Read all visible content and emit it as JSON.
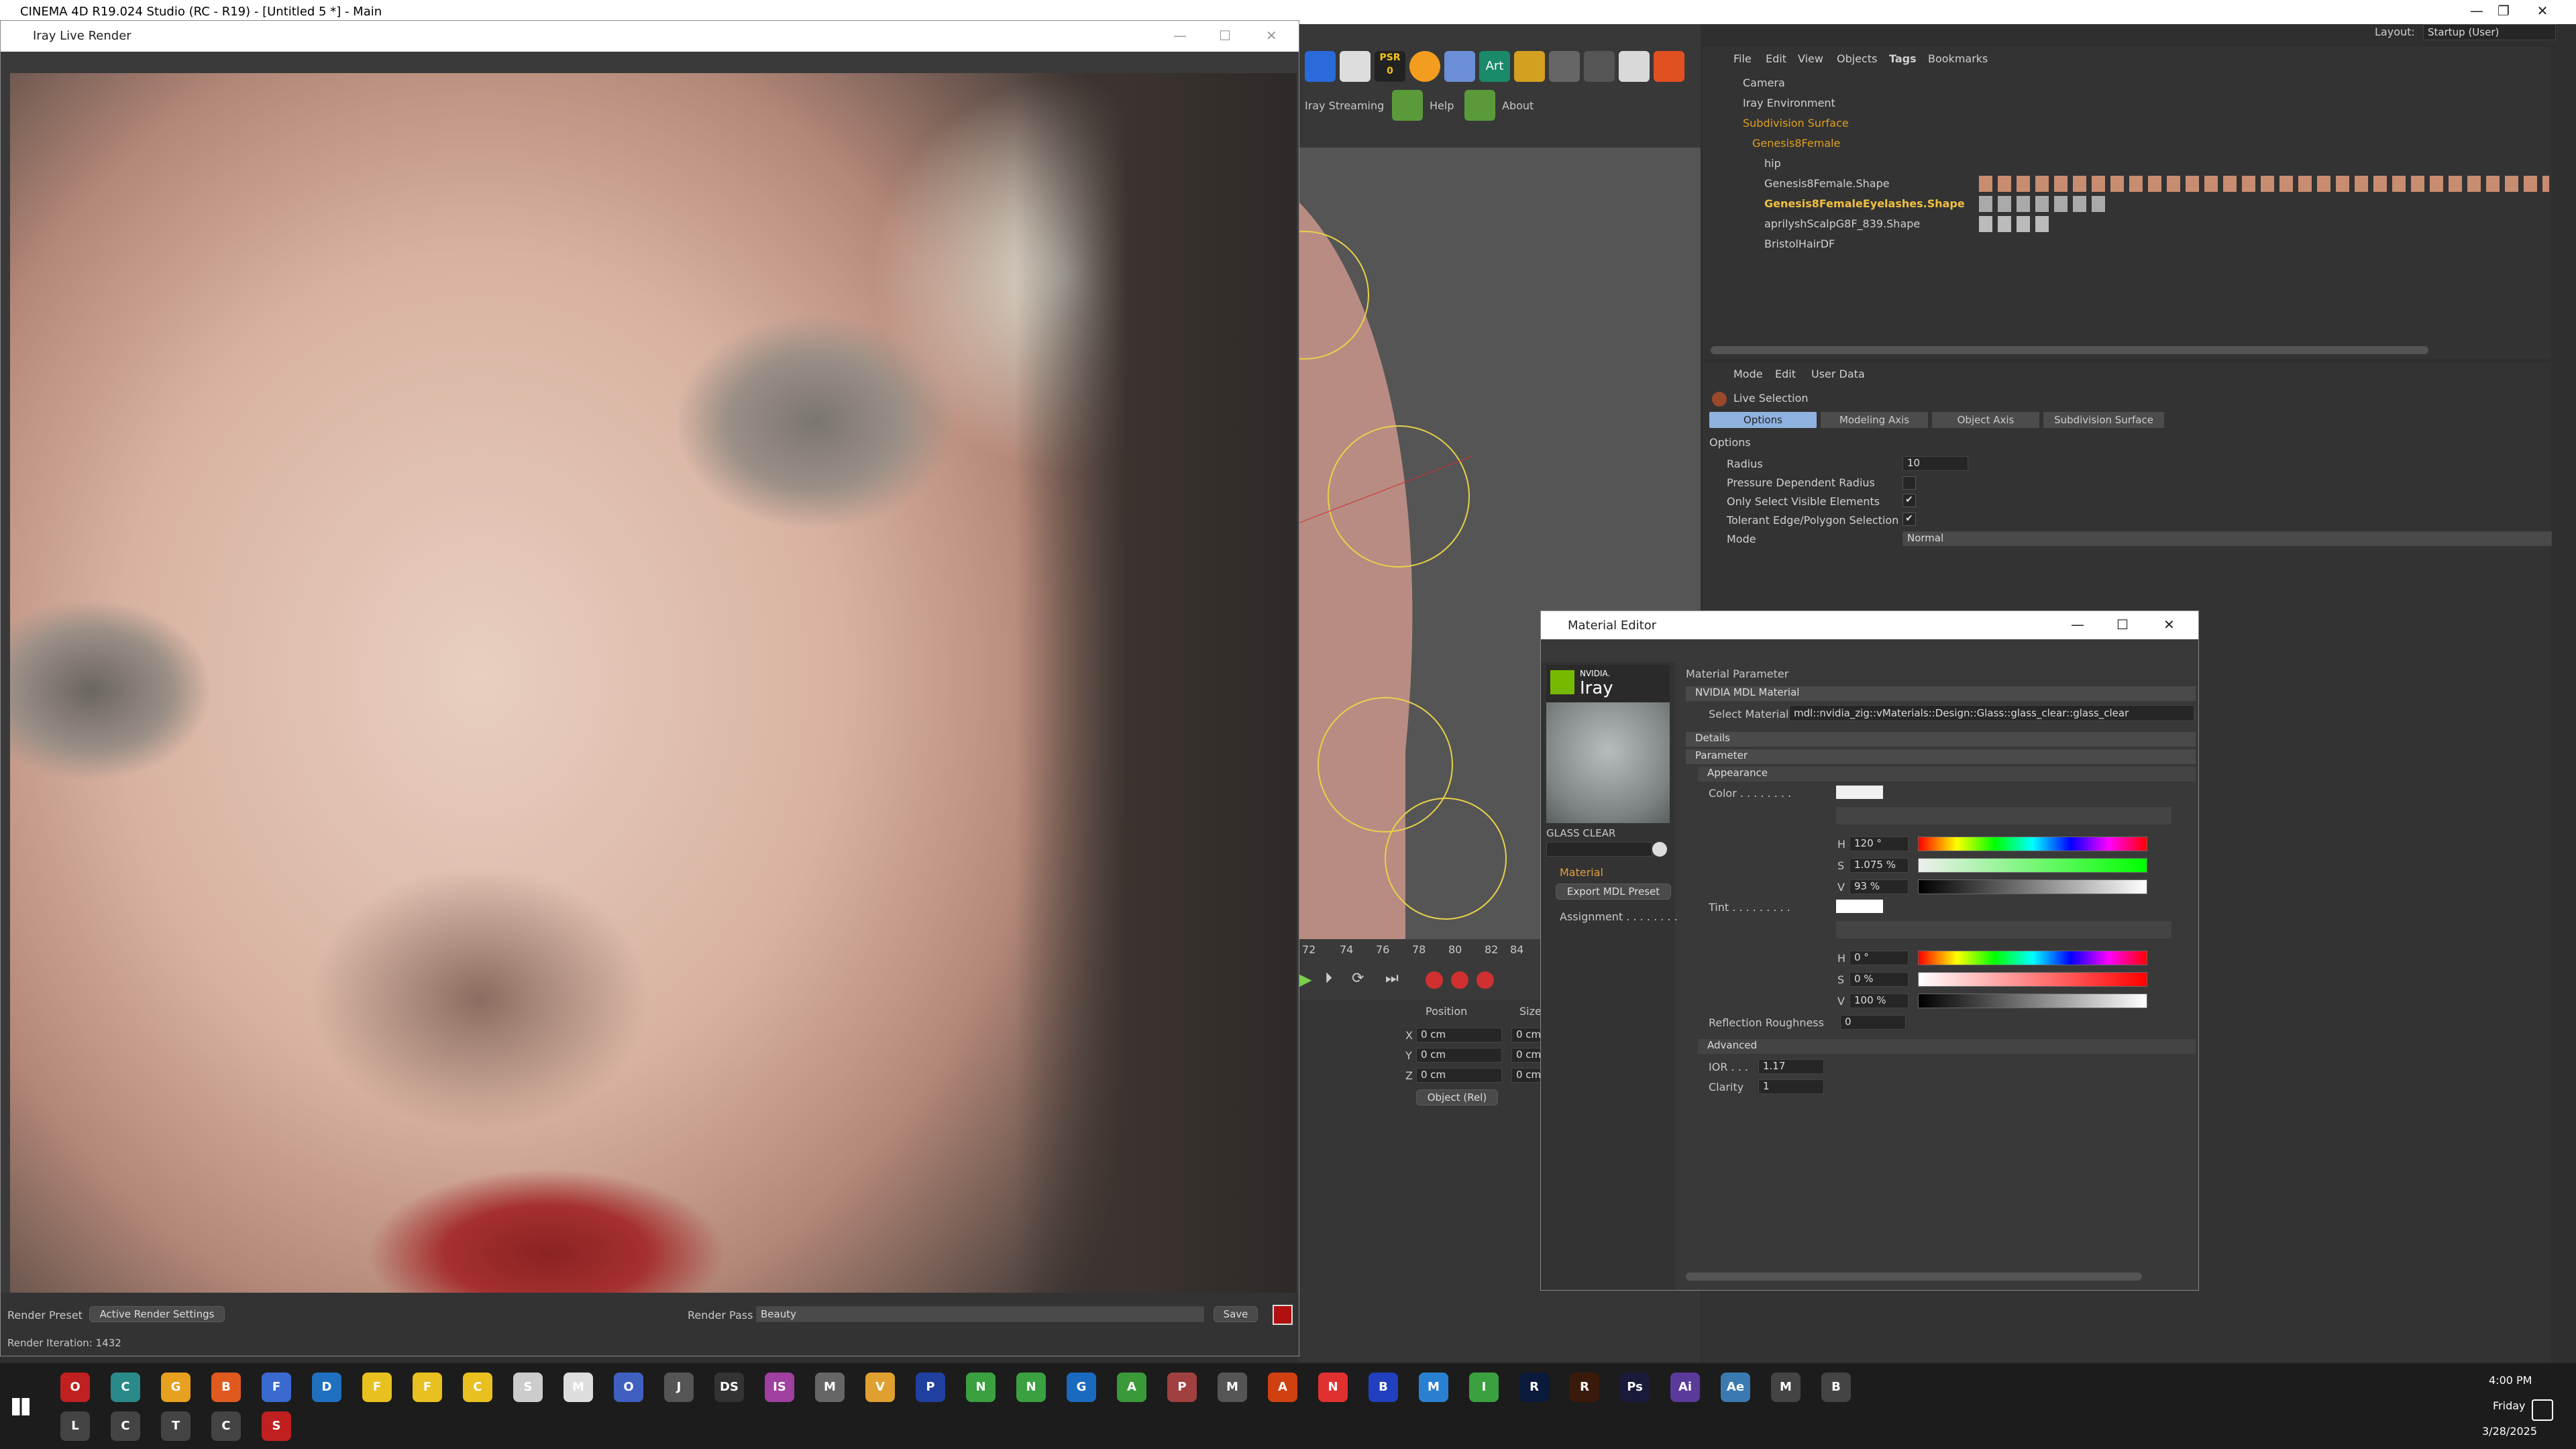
{
  "window": {
    "title": "CINEMA 4D R19.024 Studio (RC - R19) - [Untitled 5 *] - Main",
    "layout_label": "Layout:",
    "layout_value": "Startup (User)"
  },
  "iray_window": {
    "title": "Iray Live Render",
    "render_preset_label": "Render Preset",
    "render_preset_value": "Active Render Settings",
    "render_pass_label": "Render Pass",
    "render_pass_value": "Beauty",
    "save_label": "Save",
    "status": "Render Iteration: 1432"
  },
  "iray_toolbar": {
    "streaming": "Iray Streaming",
    "help": "Help",
    "about": "About",
    "psr_top": "PSR",
    "psr_bottom": "0",
    "art": "Art"
  },
  "object_manager": {
    "menu": [
      "File",
      "Edit",
      "View",
      "Objects",
      "Tags",
      "Bookmarks"
    ],
    "objects": [
      {
        "name": "Camera",
        "color": "#d0d0d0"
      },
      {
        "name": "Iray Environment",
        "color": "#d0d0d0"
      },
      {
        "name": "Subdivision Surface",
        "color": "#e0a020"
      },
      {
        "name": "Genesis8Female",
        "color": "#e0a020"
      },
      {
        "name": "hip",
        "color": "#d0d0d0"
      },
      {
        "name": "Genesis8Female.Shape",
        "color": "#d0d0d0"
      },
      {
        "name": "Genesis8FemaleEyelashes.Shape",
        "color": "#f0c040"
      },
      {
        "name": "aprilyshScalpG8F_839.Shape",
        "color": "#d0d0d0"
      },
      {
        "name": "BristolHairDF",
        "color": "#d0d0d0"
      }
    ]
  },
  "attribute_manager": {
    "menu": [
      "Mode",
      "Edit",
      "User Data"
    ],
    "tool_name": "Live Selection",
    "tabs": [
      "Options",
      "Modeling Axis",
      "Object Axis",
      "Subdivision Surface"
    ],
    "section": "Options",
    "radius_label": "Radius",
    "radius_value": "10",
    "pressure_label": "Pressure Dependent Radius",
    "only_visible_label": "Only Select Visible Elements",
    "only_visible_check": "✔",
    "tolerant_label": "Tolerant Edge/Polygon Selection",
    "tolerant_check": "✔",
    "mode_label": "Mode",
    "mode_value": "Normal"
  },
  "timeline": {
    "frames": [
      "72",
      "74",
      "76",
      "78",
      "80",
      "82",
      "84"
    ]
  },
  "coordinates": {
    "position_label": "Position",
    "size_label": "Size",
    "x_label": "X",
    "y_label": "Y",
    "z_label": "Z",
    "x_value": "0 cm",
    "y_value": "0 cm",
    "z_value": "0 cm",
    "size_x": "0 cm",
    "size_y": "0 cm",
    "size_z": "0 cm",
    "mode": "Object (Rel)"
  },
  "material_editor": {
    "title": "Material Editor",
    "logo_brand": "NVIDIA.",
    "logo_name": "Iray",
    "material_name": "GLASS CLEAR",
    "nav": [
      "Material",
      "Export MDL Preset",
      "Assignment . . . . . . . ."
    ],
    "header": "Material Parameter",
    "mdl_section": "NVIDIA MDL Material",
    "select_label": "Select Material",
    "select_value": "mdl::nvidia_zig::vMaterials::Design::Glass::glass_clear::glass_clear",
    "details": "Details",
    "parameter": "Parameter",
    "appearance": "Appearance",
    "color_label": "Color . . . . . . . .",
    "color_h": "120 °",
    "color_s": "1.075 %",
    "color_v": "93 %",
    "tint_label": "Tint . . . . . . . . .",
    "tint_h": "0 °",
    "tint_s": "0 %",
    "tint_v": "100 %",
    "h_label": "H",
    "s_label": "S",
    "v_label": "V",
    "roughness_label": "Reflection Roughness",
    "roughness_value": "0",
    "advanced": "Advanced",
    "ior_label": "IOR . . .",
    "ior_value": "1.17",
    "clarity_label": "Clarity",
    "clarity_value": "1"
  },
  "taskbar": {
    "apps": [
      "O",
      "C",
      "G",
      "B",
      "F",
      "D",
      "F",
      "F",
      "C",
      "S",
      "M",
      "O",
      "J",
      "DS",
      "IS",
      "M",
      "V",
      "P",
      "N",
      "N",
      "G",
      "A",
      "P",
      "M",
      "A",
      "N",
      "B",
      "M",
      "I",
      "R",
      "R",
      "Ps",
      "Ai",
      "Ae",
      "M",
      "B",
      "L",
      "C",
      "T",
      "C",
      "S"
    ],
    "time": "4:00 PM",
    "day": "Friday",
    "date": "3/28/2025"
  }
}
